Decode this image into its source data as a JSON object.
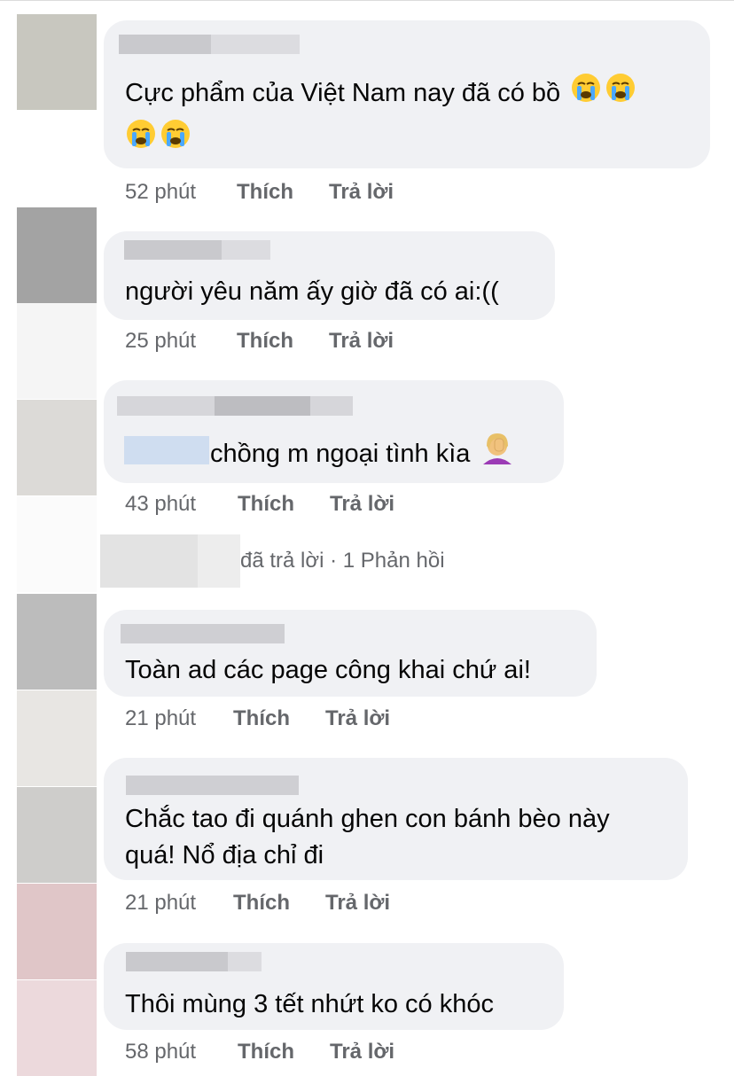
{
  "comments": [
    {
      "text_line1": "Cực phẩm của Việt Nam nay đã có bồ",
      "text_line2": "",
      "time": "52 phút",
      "like_label": "Thích",
      "reply_label": "Trả lời",
      "emoji": "crying-face"
    },
    {
      "text_line1": "người yêu năm ấy giờ đã có ai:((",
      "time": "25 phút",
      "like_label": "Thích",
      "reply_label": "Trả lời"
    },
    {
      "text_line1": "chồng m ngoại tình kìa",
      "time": "43 phút",
      "like_label": "Thích",
      "reply_label": "Trả lời",
      "emoji": "woman-facepalming"
    },
    {
      "text_line1": "Toàn ad các page công khai chứ ai!",
      "time": "21 phút",
      "like_label": "Thích",
      "reply_label": "Trả lời"
    },
    {
      "text_line1": "Chắc tao đi quánh ghen con bánh bèo này",
      "text_line2": "quá! Nổ địa chỉ đi",
      "time": "21 phút",
      "like_label": "Thích",
      "reply_label": "Trả lời"
    },
    {
      "text_line1": "Thôi mùng 3 tết nhứt ko có khóc",
      "time": "58 phút",
      "like_label": "Thích",
      "reply_label": "Trả lời"
    }
  ],
  "reply_summary": {
    "text": "đã trả lời · 1 Phản hồi"
  },
  "colors": {
    "bubble": "#f0f1f4",
    "secondary_text": "#65676b",
    "primary_text": "#050505"
  }
}
